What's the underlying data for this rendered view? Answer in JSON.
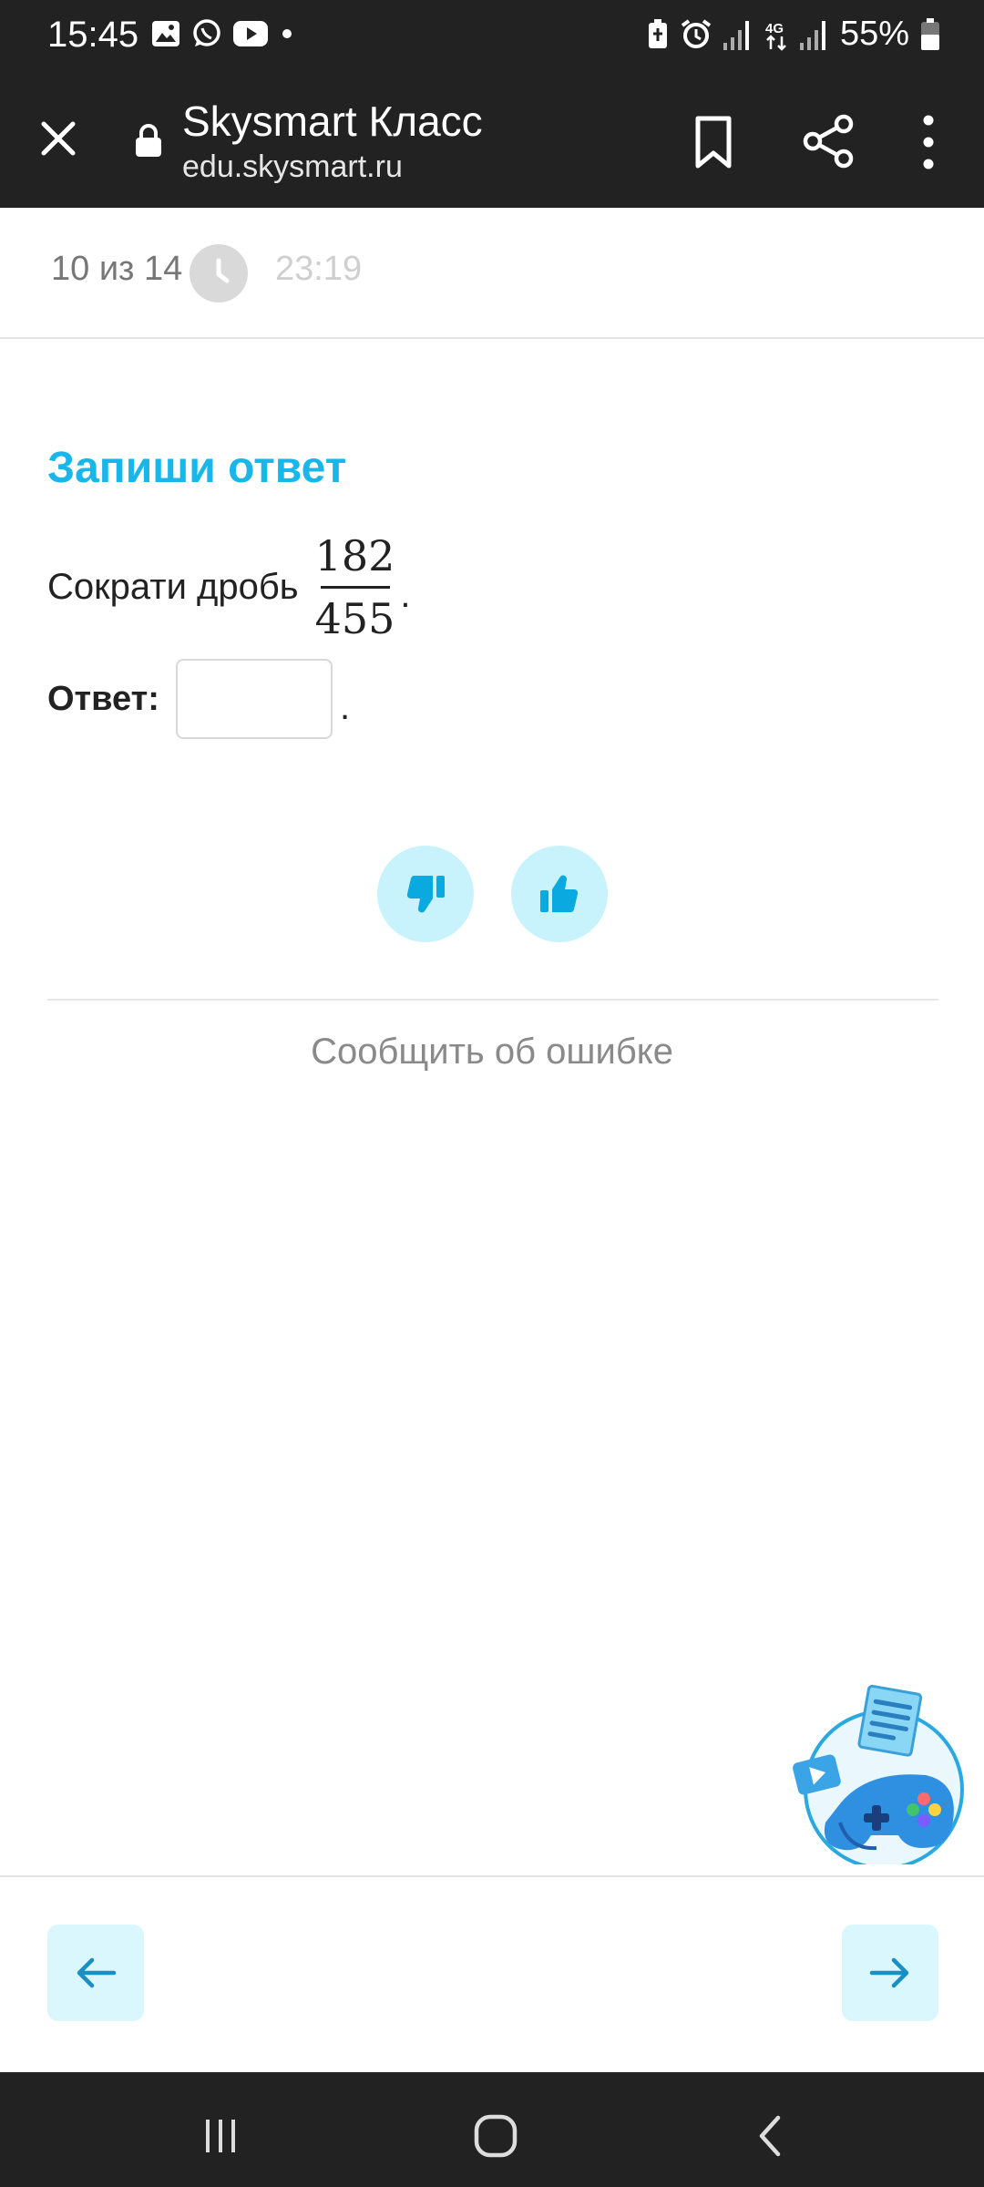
{
  "status_bar": {
    "time": "15:45",
    "battery": "55%",
    "left_icons": [
      "gallery-icon",
      "whatsapp-icon",
      "youtube-icon",
      "dot-icon"
    ],
    "right_icons": [
      "battery-saver-icon",
      "alarm-icon",
      "signal-icon",
      "4g-icon",
      "signal-icon",
      "battery-icon"
    ]
  },
  "browser": {
    "title": "Skysmart Класс",
    "url": "edu.skysmart.ru"
  },
  "progress": {
    "counter": "10 из 14",
    "timer": "23:19"
  },
  "task": {
    "heading": "Запиши ответ",
    "text": "Сократи дробь",
    "numerator": "182",
    "denominator": "455",
    "punct": ".",
    "answer_label": "Ответ:",
    "answer_value": "",
    "answer_punct": "."
  },
  "feedback": {
    "report_label": "Сообщить об ошибке"
  },
  "colors": {
    "accent": "#19b6ea",
    "button_bg": "#c9f3fc",
    "nav_bg": "#d9f7fd",
    "bar_bg": "#222222"
  }
}
